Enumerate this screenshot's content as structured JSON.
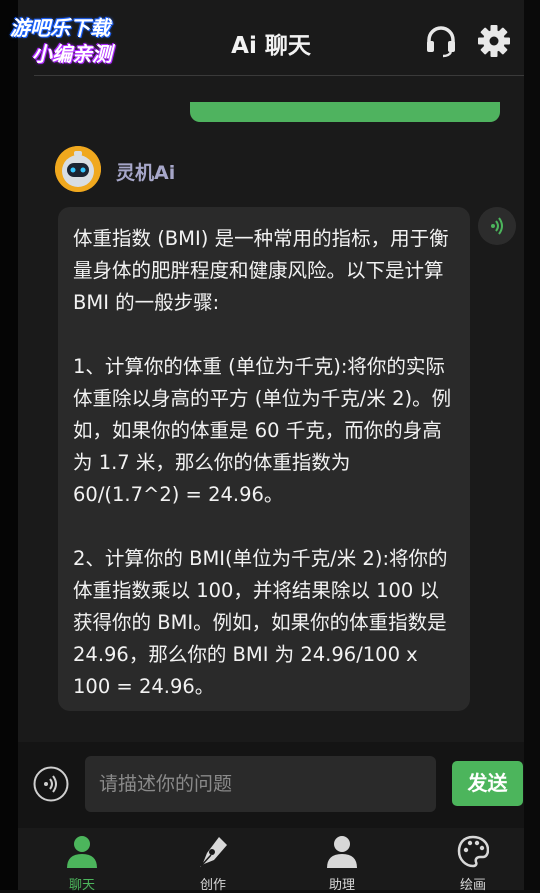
{
  "header": {
    "title": "Ai 聊天",
    "watermark_line1": "游吧乐下载",
    "watermark_line2": "小编亲测"
  },
  "chat": {
    "bot_name": "灵机Ai",
    "paragraphs": [
      "体重指数 (BMI) 是一种常用的指标，用于衡量身体的肥胖程度和健康风险。以下是计算 BMI 的一般步骤:",
      "1、计算你的体重 (单位为千克):将你的实际体重除以身高的平方 (单位为千克/米 2)。例如，如果你的体重是 60 千克，而你的身高为 1.7 米，那么你的体重指数为 60/(1.7^2) = 24.96。",
      "2、计算你的 BMI(单位为千克/米 2):将你的体重指数乘以 100，并将结果除以 100 以获得你的 BMI。例如，如果你的体重指数是 24.96，那么你的 BMI 为 24.96/100 x 100 = 24.96。"
    ]
  },
  "input": {
    "placeholder": "请描述你的问题",
    "send_label": "发送"
  },
  "nav": {
    "items": [
      {
        "label": "聊天",
        "icon": "person-icon",
        "active": true
      },
      {
        "label": "创作",
        "icon": "pen-nib-icon",
        "active": false
      },
      {
        "label": "助理",
        "icon": "person-icon",
        "active": false
      },
      {
        "label": "绘画",
        "icon": "palette-icon",
        "active": false
      }
    ]
  },
  "colors": {
    "accent": "#4cb55c",
    "bot_name": "#a7a7c9",
    "bubble": "#2a2a2a",
    "background": "#1a1a1a"
  }
}
